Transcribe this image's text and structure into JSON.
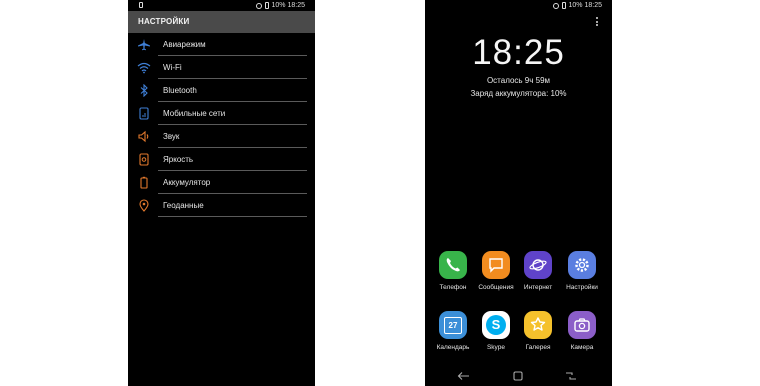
{
  "left_screen": {
    "status": {
      "text": "10% 18:25"
    },
    "header_title": "НАСТРОЙКИ",
    "items": [
      {
        "label": "Авиарежим",
        "icon": "airplane-icon",
        "color": "#3f7fd6"
      },
      {
        "label": "Wi-Fi",
        "icon": "wifi-icon",
        "color": "#3f7fd6"
      },
      {
        "label": "Bluetooth",
        "icon": "bluetooth-icon",
        "color": "#3f7fd6"
      },
      {
        "label": "Мобильные сети",
        "icon": "mobile-network-icon",
        "color": "#3f7fd6"
      },
      {
        "label": "Звук",
        "icon": "sound-icon",
        "color": "#e2792d"
      },
      {
        "label": "Яркость",
        "icon": "brightness-icon",
        "color": "#e2792d"
      },
      {
        "label": "Аккумулятор",
        "icon": "battery-icon",
        "color": "#e2792d"
      },
      {
        "label": "Геоданные",
        "icon": "location-icon",
        "color": "#e2792d"
      }
    ]
  },
  "right_screen": {
    "status": {
      "text": "10% 18:25"
    },
    "clock": "18:25",
    "time_left": "Осталось 9ч 59м",
    "battery_charge": "Заряд аккумулятора: 10%",
    "apps_row1": [
      {
        "label": "Телефон",
        "icon": "phone-icon",
        "color": "#38b44a"
      },
      {
        "label": "Сообщения",
        "icon": "messages-icon",
        "color": "#f28c1f"
      },
      {
        "label": "Интернет",
        "icon": "internet-icon",
        "color": "#5f43c9"
      },
      {
        "label": "Настройки",
        "icon": "settings-icon",
        "color": "#5a7ee0"
      }
    ],
    "apps_row2": [
      {
        "label": "Календарь",
        "icon": "calendar-icon",
        "color": "#3c8fd8",
        "day": "27"
      },
      {
        "label": "Skype",
        "icon": "skype-icon",
        "color": "#ffffff"
      },
      {
        "label": "Галерея",
        "icon": "gallery-icon",
        "color": "#f5c12c"
      },
      {
        "label": "Камера",
        "icon": "camera-icon",
        "color": "#8b5ec8"
      }
    ]
  }
}
